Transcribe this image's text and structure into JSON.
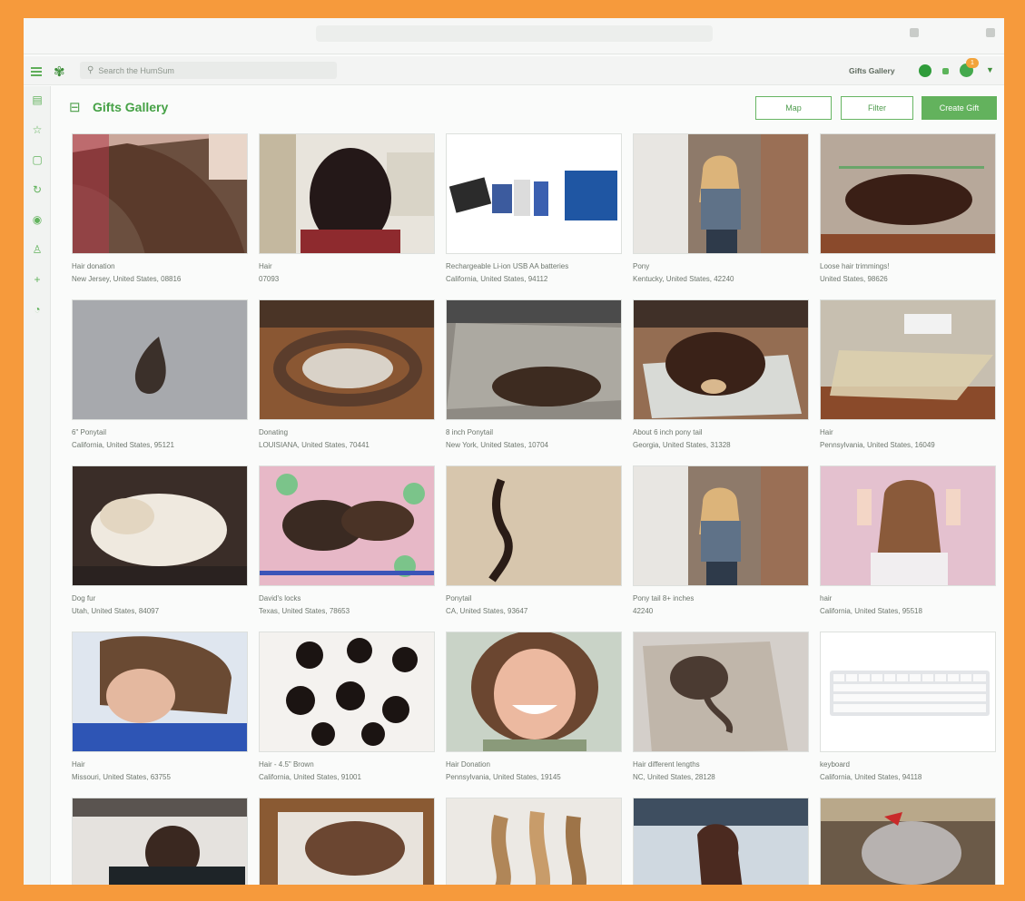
{
  "header": {
    "search_placeholder": "Search the HumSum",
    "gallery_link": "Gifts Gallery",
    "notification_count": "1"
  },
  "page": {
    "title": "Gifts Gallery",
    "map_button": "Map",
    "filter_button": "Filter",
    "create_button": "Create Gift"
  },
  "sidebar": {
    "icons": [
      "gift-icon",
      "star-icon",
      "calendar-icon",
      "refresh-icon",
      "eye-icon",
      "user-icon",
      "plus-icon",
      "clock-icon"
    ]
  },
  "gifts": [
    {
      "title": "Hair donation",
      "location": "New Jersey, United States, 08816"
    },
    {
      "title": "Hair",
      "location": "07093"
    },
    {
      "title": "Rechargeable Li-ion USB AA batteries",
      "location": "California, United States, 94112"
    },
    {
      "title": "Pony",
      "location": "Kentucky, United States, 42240"
    },
    {
      "title": "Loose hair trimmings!",
      "location": "United States, 98626"
    },
    {
      "title": "6\" Ponytail",
      "location": "California, United States, 95121"
    },
    {
      "title": "Donating",
      "location": "LOUISIANA, United States, 70441"
    },
    {
      "title": "8 inch Ponytail",
      "location": "New York, United States, 10704"
    },
    {
      "title": "About 6 inch pony tail",
      "location": "Georgia, United States, 31328"
    },
    {
      "title": "Hair",
      "location": "Pennsylvania, United States, 16049"
    },
    {
      "title": "Dog fur",
      "location": "Utah, United States, 84097"
    },
    {
      "title": "David's locks",
      "location": "Texas, United States, 78653"
    },
    {
      "title": "Ponytail",
      "location": "CA, United States, 93647"
    },
    {
      "title": "Pony tail 8+ inches",
      "location": "42240"
    },
    {
      "title": "hair",
      "location": "California, United States, 95518"
    },
    {
      "title": "Hair",
      "location": "Missouri, United States, 63755"
    },
    {
      "title": "Hair - 4.5\" Brown",
      "location": "California, United States, 91001"
    },
    {
      "title": "Hair Donation",
      "location": "Pennsylvania, United States, 19145"
    },
    {
      "title": "Hair different lengths",
      "location": "NC, United States, 28128"
    },
    {
      "title": "keyboard",
      "location": "California, United States, 94118"
    },
    {
      "title": "",
      "location": ""
    },
    {
      "title": "",
      "location": ""
    },
    {
      "title": "",
      "location": ""
    },
    {
      "title": "",
      "location": ""
    },
    {
      "title": "",
      "location": ""
    }
  ]
}
